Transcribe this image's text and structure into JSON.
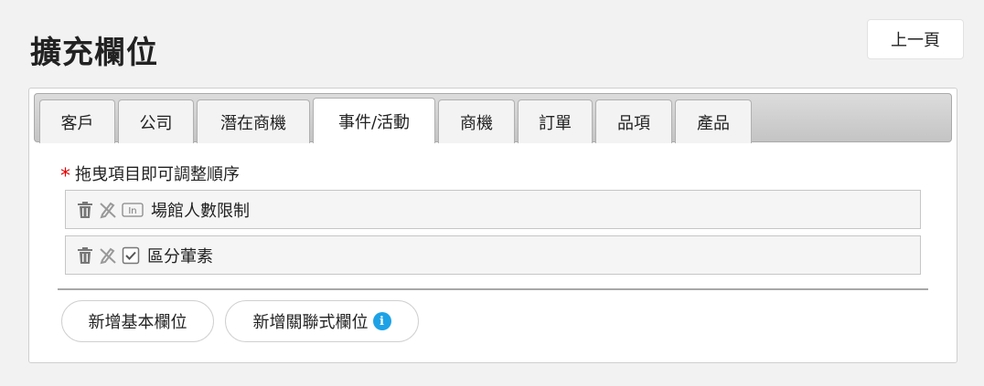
{
  "header": {
    "title": "擴充欄位",
    "back_label": "上一頁"
  },
  "tabs": [
    {
      "label": "客戶"
    },
    {
      "label": "公司"
    },
    {
      "label": "潛在商機"
    },
    {
      "label": "事件/活動",
      "active": true
    },
    {
      "label": "商機"
    },
    {
      "label": "訂單"
    },
    {
      "label": "品項"
    },
    {
      "label": "產品"
    }
  ],
  "hint": {
    "required_mark": "*",
    "text": "拖曳項目即可調整順序"
  },
  "fields": [
    {
      "label": "場館人數限制",
      "type_icon": "integer-field-icon"
    },
    {
      "label": "區分葷素",
      "type_icon": "checkbox-field-icon"
    }
  ],
  "actions": {
    "add_basic": "新增基本欄位",
    "add_relational": "新增關聯式欄位",
    "info_glyph": "i"
  },
  "colors": {
    "required": "#e60000",
    "info": "#1ea2e6"
  }
}
